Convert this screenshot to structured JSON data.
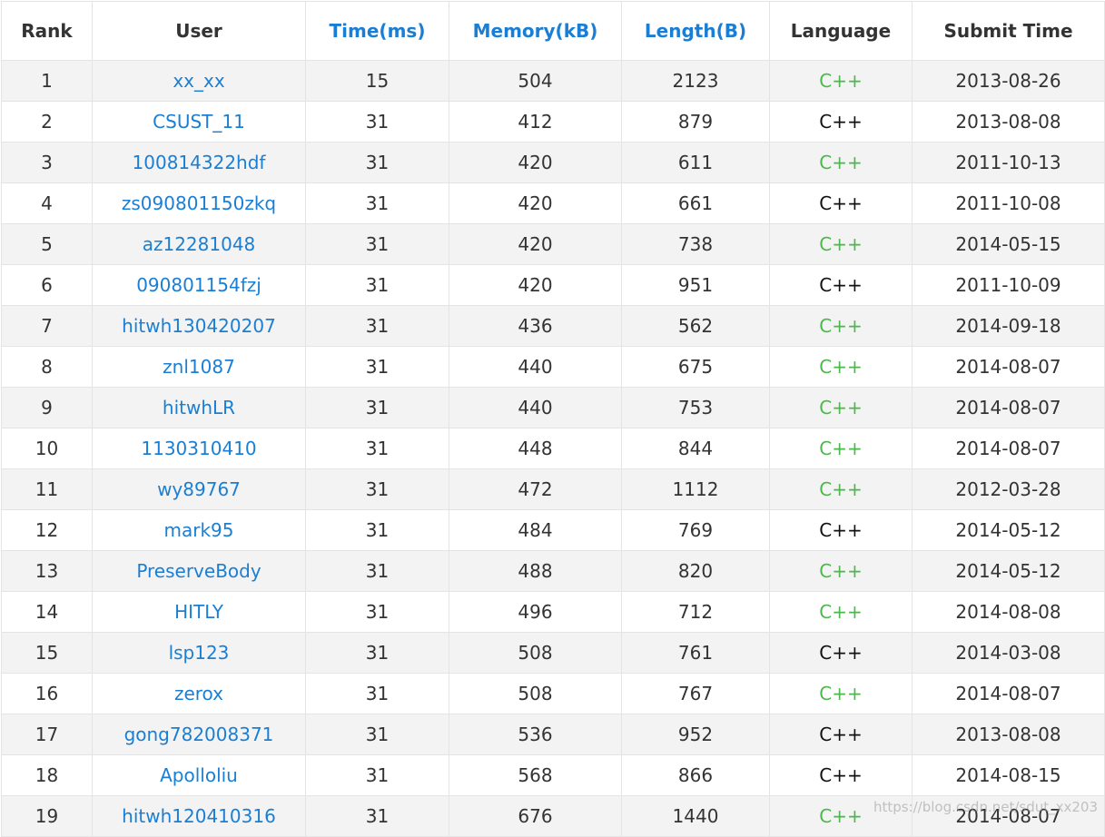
{
  "headers": [
    {
      "label": "Rank",
      "sortable": false
    },
    {
      "label": "User",
      "sortable": false
    },
    {
      "label": "Time(ms)",
      "sortable": true
    },
    {
      "label": "Memory(kB)",
      "sortable": true
    },
    {
      "label": "Length(B)",
      "sortable": true
    },
    {
      "label": "Language",
      "sortable": false
    },
    {
      "label": "Submit Time",
      "sortable": false
    }
  ],
  "rows": [
    {
      "rank": "1",
      "user": "xx_xx",
      "time": "15",
      "memory": "504",
      "length": "2123",
      "language": "C++",
      "lang_color": "green",
      "submit": "2013-08-26"
    },
    {
      "rank": "2",
      "user": "CSUST_11",
      "time": "31",
      "memory": "412",
      "length": "879",
      "language": "C++",
      "lang_color": "black",
      "submit": "2013-08-08"
    },
    {
      "rank": "3",
      "user": "100814322hdf",
      "time": "31",
      "memory": "420",
      "length": "611",
      "language": "C++",
      "lang_color": "green",
      "submit": "2011-10-13"
    },
    {
      "rank": "4",
      "user": "zs090801150zkq",
      "time": "31",
      "memory": "420",
      "length": "661",
      "language": "C++",
      "lang_color": "black",
      "submit": "2011-10-08"
    },
    {
      "rank": "5",
      "user": "az12281048",
      "time": "31",
      "memory": "420",
      "length": "738",
      "language": "C++",
      "lang_color": "green",
      "submit": "2014-05-15"
    },
    {
      "rank": "6",
      "user": "090801154fzj",
      "time": "31",
      "memory": "420",
      "length": "951",
      "language": "C++",
      "lang_color": "black",
      "submit": "2011-10-09"
    },
    {
      "rank": "7",
      "user": "hitwh130420207",
      "time": "31",
      "memory": "436",
      "length": "562",
      "language": "C++",
      "lang_color": "green",
      "submit": "2014-09-18"
    },
    {
      "rank": "8",
      "user": "znl1087",
      "time": "31",
      "memory": "440",
      "length": "675",
      "language": "C++",
      "lang_color": "green",
      "submit": "2014-08-07"
    },
    {
      "rank": "9",
      "user": "hitwhLR",
      "time": "31",
      "memory": "440",
      "length": "753",
      "language": "C++",
      "lang_color": "green",
      "submit": "2014-08-07"
    },
    {
      "rank": "10",
      "user": "1130310410",
      "time": "31",
      "memory": "448",
      "length": "844",
      "language": "C++",
      "lang_color": "green",
      "submit": "2014-08-07"
    },
    {
      "rank": "11",
      "user": "wy89767",
      "time": "31",
      "memory": "472",
      "length": "1112",
      "language": "C++",
      "lang_color": "green",
      "submit": "2012-03-28"
    },
    {
      "rank": "12",
      "user": "mark95",
      "time": "31",
      "memory": "484",
      "length": "769",
      "language": "C++",
      "lang_color": "black",
      "submit": "2014-05-12"
    },
    {
      "rank": "13",
      "user": "PreserveBody",
      "time": "31",
      "memory": "488",
      "length": "820",
      "language": "C++",
      "lang_color": "green",
      "submit": "2014-05-12"
    },
    {
      "rank": "14",
      "user": "HITLY",
      "time": "31",
      "memory": "496",
      "length": "712",
      "language": "C++",
      "lang_color": "green",
      "submit": "2014-08-08"
    },
    {
      "rank": "15",
      "user": "lsp123",
      "time": "31",
      "memory": "508",
      "length": "761",
      "language": "C++",
      "lang_color": "black",
      "submit": "2014-03-08"
    },
    {
      "rank": "16",
      "user": "zerox",
      "time": "31",
      "memory": "508",
      "length": "767",
      "language": "C++",
      "lang_color": "green",
      "submit": "2014-08-07"
    },
    {
      "rank": "17",
      "user": "gong782008371",
      "time": "31",
      "memory": "536",
      "length": "952",
      "language": "C++",
      "lang_color": "black",
      "submit": "2013-08-08"
    },
    {
      "rank": "18",
      "user": "Apolloliu",
      "time": "31",
      "memory": "568",
      "length": "866",
      "language": "C++",
      "lang_color": "black",
      "submit": "2014-08-15"
    },
    {
      "rank": "19",
      "user": "hitwh120410316",
      "time": "31",
      "memory": "676",
      "length": "1440",
      "language": "C++",
      "lang_color": "green",
      "submit": "2014-08-07"
    }
  ],
  "colors": {
    "link_blue": "#1a7fd4",
    "language_green": "#4ab84a",
    "language_black": "#111111",
    "stripe": "#f3f3f3"
  },
  "watermark": "https://blog.csdn.net/sdut_xx203"
}
